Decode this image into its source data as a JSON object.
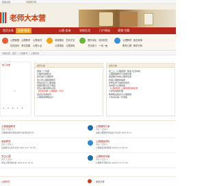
{
  "topbar": {
    "left_text": "家庭文档",
    "right_text": "凤凰教育网"
  },
  "site": {
    "logo_title": "老师大本营"
  },
  "nav": {
    "items": [
      {
        "label": "首页头条"
      },
      {
        "label": "论教·随笔"
      },
      {
        "label": "心理·咨询"
      },
      {
        "label": "学校生活"
      },
      {
        "label": "门户网站"
      },
      {
        "label": "视频·专题"
      }
    ]
  },
  "subnav": {
    "col1": [
      "心理家园",
      "心理教育",
      "在线测评",
      "考试答题"
    ],
    "col2": [
      "心理读书",
      "心理沙龙",
      "心理咨询",
      "心理测试"
    ],
    "col3": [
      "测量题目",
      "艺术疗法",
      "心理电影",
      "心理游戏"
    ],
    "col4": [
      "国学讲坛",
      "诗词欣赏",
      "书法练习",
      "一诗一画"
    ],
    "col5": [
      "心理教育",
      "励志故事",
      "教育心理",
      "教学分析"
    ]
  },
  "breadcrumb": {
    "text": "当前位置：首页 > 心理教育 > 心理咨询"
  },
  "sidebar": {
    "heading": "热门文章",
    "count": "1",
    "pager": "4 5 6 7 8"
  },
  "panel_left": {
    "title": "推荐文章",
    "items": [
      "题第一个问题",
      "心理学基础知识",
      "如何进行心理疏导",
      "青少年心理健康教育",
      "家庭关系与儿童发展",
      "情绪管理与压力调适",
      "学生心理问题的识别",
      "【在线咨询】心理辅导（5月）",
      "班主任沟通技巧",
      "心理健康课程设计"
    ]
  },
  "panel_right": {
    "title": "最新文章",
    "items": [
      "初二上（心理健康）教案 生活中的",
      "心理健康教育与班级管理",
      "家庭教育中的心理学应用",
      "校园心理剧的编排",
      "中学生学习动机的培养",
      "中考复习心理调适",
      "【心理测评】心理健康自我检测",
      "小学生情绪管理",
      "教师职业倦怠与心理保健",
      "人际关系第一次讲座"
    ]
  },
  "list": [
    {
      "name": "心理健康教育",
      "meta": "浏览 3 回复 1",
      "desc": "心理健康教育相关资料与在线交流分享",
      "name2": "心理辅导方案",
      "meta2": "浏览 1 回复 1",
      "desc2": "班级心理辅导方案设计与交流 2023-4-14"
    },
    {
      "name": "家庭教育",
      "meta": "浏览 1 回复 1",
      "desc": "家庭教育心得与交流 2023-4-17 10:16",
      "name2": "心理健康资料",
      "meta2": "浏览 1 回复 1",
      "desc2": "心理健康资料整理 2023-4-13 16:42"
    },
    {
      "name": "学生心理",
      "meta": "浏览 1 回复 1",
      "desc": "学生心理问题分析 2023-4-11 10:11",
      "name2": "心理教育专题",
      "meta2": "浏览 1 回复 1",
      "desc2": "心理教育专题讨论 2023-4-11 17:20"
    }
  ],
  "section_bottom": {
    "left": "心理专栏",
    "right": "家校共育"
  },
  "colors": {
    "brand": "#b5261b",
    "accent": "#f0a31c",
    "logo": "#c8411b"
  }
}
